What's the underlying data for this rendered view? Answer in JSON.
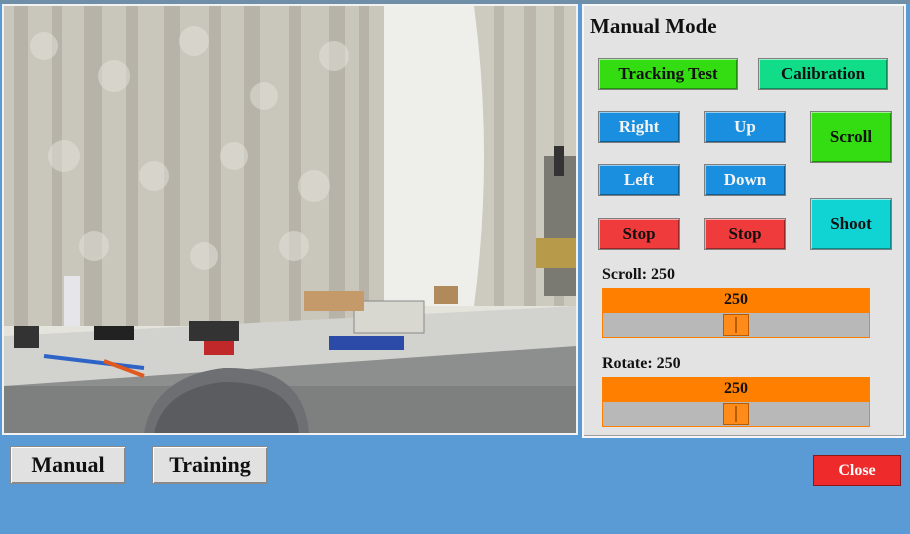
{
  "panel": {
    "title": "Manual Mode",
    "tracking_test_label": "Tracking Test",
    "calibration_label": "Calibration",
    "right_label": "Right",
    "up_label": "Up",
    "left_label": "Left",
    "down_label": "Down",
    "stop_left_label": "Stop",
    "stop_right_label": "Stop",
    "scroll_label": "Scroll",
    "shoot_label": "Shoot",
    "scroll_caption": "Scroll: 250",
    "scroll_value": "250",
    "scroll_fraction": 0.5,
    "rotate_caption": "Rotate: 250",
    "rotate_value": "250",
    "rotate_fraction": 0.5
  },
  "bottom": {
    "manual_label": "Manual",
    "training_label": "Training",
    "close_label": "Close"
  },
  "colors": {
    "background": "#5b9bd5",
    "green": "#33dd11",
    "teal": "#11dd88",
    "blue": "#1a8fe0",
    "red": "#ef3b3b",
    "cyan": "#10d4d4",
    "orange": "#ff8000"
  }
}
